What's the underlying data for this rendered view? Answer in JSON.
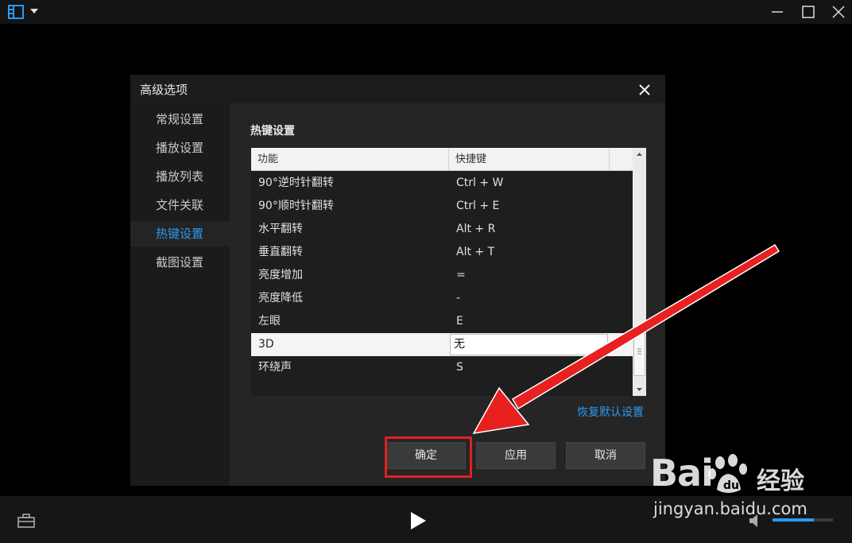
{
  "colors": {
    "accent": "#2b9af3",
    "highlight_red": "#e02020",
    "dialog_bg": "#252525",
    "nav_bg": "#1b1b1b"
  },
  "topbar": {
    "logo_icon": "film-strip-icon",
    "dropdown_icon": "caret-down-icon",
    "minimize_icon": "minimize-icon",
    "maximize_icon": "maximize-icon",
    "close_icon": "close-icon"
  },
  "dialog": {
    "title": "高级选项",
    "close_icon": "close-icon",
    "nav": [
      {
        "label": "常规设置",
        "active": false
      },
      {
        "label": "播放设置",
        "active": false
      },
      {
        "label": "播放列表",
        "active": false
      },
      {
        "label": "文件关联",
        "active": false
      },
      {
        "label": "热键设置",
        "active": true
      },
      {
        "label": "截图设置",
        "active": false
      }
    ],
    "section_title": "热键设置",
    "table": {
      "columns": [
        "功能",
        "快捷键"
      ],
      "rows": [
        {
          "func": "90°逆时针翻转",
          "key": "Ctrl + W"
        },
        {
          "func": "90°顺时针翻转",
          "key": "Ctrl + E"
        },
        {
          "func": "水平翻转",
          "key": "Alt + R"
        },
        {
          "func": "垂直翻转",
          "key": "Alt + T"
        },
        {
          "func": "亮度增加",
          "key": "="
        },
        {
          "func": "亮度降低",
          "key": "-"
        },
        {
          "func": "左眼",
          "key": "E"
        },
        {
          "func": "3D",
          "key": "无",
          "selected": true
        },
        {
          "func": "环绕声",
          "key": "S"
        }
      ]
    },
    "restore_defaults": "恢复默认设置",
    "buttons": {
      "ok": "确定",
      "apply": "应用",
      "cancel": "取消"
    }
  },
  "bottombar": {
    "toolbox_icon": "toolbox-icon",
    "play_icon": "play-icon",
    "volume_icon": "volume-icon",
    "volume_level": 0.68
  },
  "watermark": {
    "brand": "Bai",
    "brand_suffix": "经验",
    "url": "jingyan.baidu.com"
  }
}
